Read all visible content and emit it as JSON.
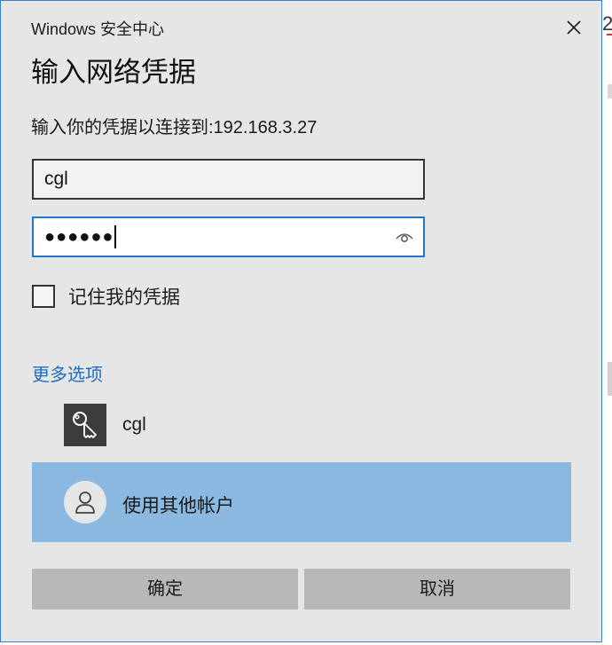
{
  "window": {
    "app_title": "Windows 安全中心"
  },
  "dialog": {
    "title": "输入网络凭据",
    "prompt": "输入你的凭据以连接到:192.168.3.27"
  },
  "form": {
    "username_value": "cgl",
    "password_masked": "●●●●●●",
    "remember_label": "记住我的凭据",
    "remember_checked": false
  },
  "more_options": {
    "label": "更多选项",
    "accounts": [
      {
        "label": "cgl",
        "icon": "key-icon"
      },
      {
        "label": "使用其他帐户",
        "icon": "person-icon",
        "selected": true
      }
    ]
  },
  "buttons": {
    "ok": "确定",
    "cancel": "取消"
  },
  "colors": {
    "dialog_bg": "#e6e6e6",
    "accent": "#1e78c8",
    "link": "#1e6fc0",
    "selection": "#8ab8e0",
    "button_bg": "#b8b8b8"
  }
}
